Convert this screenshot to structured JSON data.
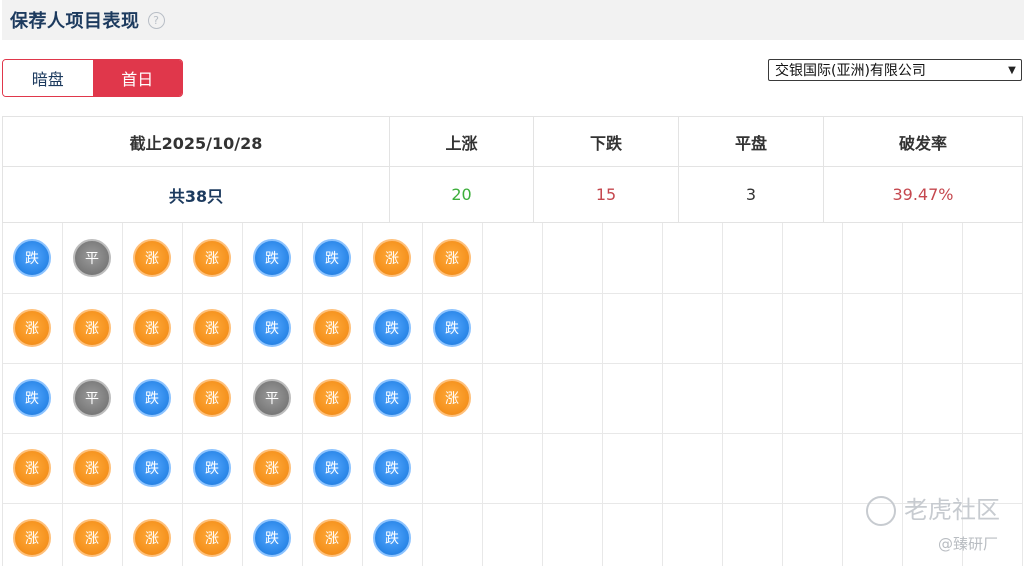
{
  "header": {
    "title": "保荐人项目表现",
    "help_icon": "?"
  },
  "toggle": {
    "options": [
      "暗盘",
      "首日"
    ],
    "active": "首日"
  },
  "sponsor_select": {
    "selected": "交银国际(亚洲)有限公司"
  },
  "summary": {
    "headers": [
      "截止2025/10/28",
      "上涨",
      "下跌",
      "平盘",
      "破发率"
    ],
    "total": "共38只",
    "up": "20",
    "down": "15",
    "flat": "3",
    "break_rate": "39.47%"
  },
  "colors": {
    "accent_red": "#e0374b",
    "up_green": "#3cae3a",
    "down_red": "#c5474e",
    "coin_up": "#f5921e",
    "coin_down": "#2b87e8",
    "coin_flat": "#7b7b7b"
  },
  "coin_labels": {
    "up": "涨",
    "down": "跌",
    "flat": "平"
  },
  "grid": {
    "columns": 17,
    "rows": [
      [
        "down",
        "flat",
        "up",
        "up",
        "down",
        "down",
        "up",
        "up"
      ],
      [
        "up",
        "up",
        "up",
        "up",
        "down",
        "up",
        "down",
        "down"
      ],
      [
        "down",
        "flat",
        "down",
        "up",
        "flat",
        "up",
        "down",
        "up"
      ],
      [
        "up",
        "up",
        "down",
        "down",
        "up",
        "down",
        "down"
      ],
      [
        "up",
        "up",
        "up",
        "up",
        "down",
        "up",
        "down"
      ]
    ]
  },
  "watermark": {
    "main": "老虎社区",
    "sub": "@臻研厂"
  }
}
